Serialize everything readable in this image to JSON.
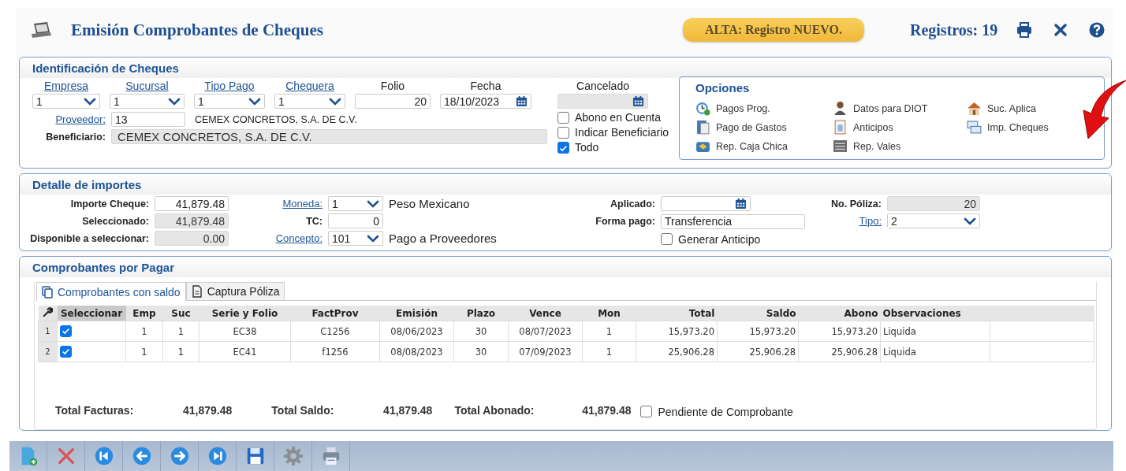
{
  "header": {
    "title": "Emisión Comprobantes de Cheques",
    "badge": "ALTA: Registro NUEVO.",
    "records": "Registros: 19"
  },
  "identificacion": {
    "title": "Identificación de Cheques",
    "selects": [
      {
        "label": "Empresa",
        "value": "1"
      },
      {
        "label": "Sucursal",
        "value": "1"
      },
      {
        "label": "Tipo Pago",
        "value": "1"
      },
      {
        "label": "Chequera",
        "value": "1"
      }
    ],
    "folio": {
      "label": "Folio",
      "value": "20"
    },
    "fecha": {
      "label": "Fecha",
      "value": "18/10/2023"
    },
    "cancelado": {
      "label": "Cancelado"
    },
    "checks": [
      {
        "label": "Abono en Cuenta",
        "checked": false
      },
      {
        "label": "Indicar Beneficiario",
        "checked": false
      },
      {
        "label": "Todo",
        "checked": true
      }
    ],
    "proveedor": {
      "label": "Proveedor:",
      "value": "13",
      "name": "CEMEX CONCRETOS, S.A. DE C.V."
    },
    "beneficiario": {
      "label": "Beneficiario:",
      "value": "CEMEX CONCRETOS, S.A. DE C.V."
    }
  },
  "opciones": {
    "title": "Opciones",
    "items": [
      "Pagos Prog.",
      "Datos para DIOT",
      "Suc. Aplica",
      "Pago de Gastos",
      "Anticipos",
      "Imp. Cheques",
      "Rep. Caja Chica",
      "Rep. Vales"
    ]
  },
  "detalle": {
    "title": "Detalle de importes",
    "importes": [
      {
        "label": "Importe Cheque:",
        "value": "41,879.48",
        "readonly": false
      },
      {
        "label": "Seleccionado:",
        "value": "41,879.48",
        "readonly": true
      },
      {
        "label": "Disponible a seleccionar:",
        "value": "0.00",
        "readonly": true
      }
    ],
    "moneda": {
      "label": "Moneda:",
      "value": "1",
      "description": "Peso Mexicano"
    },
    "tc": {
      "label": "TC:",
      "value": "0"
    },
    "concepto": {
      "label": "Concepto:",
      "value": "101",
      "description": "Pago a Proveedores"
    },
    "aplicado": {
      "label": "Aplicado:"
    },
    "forma_pago": {
      "label": "Forma pago:",
      "value": "Transferencia"
    },
    "generar_anticipo": {
      "label": "Generar Anticipo",
      "checked": false
    },
    "poliza": {
      "label": "No. Póliza:",
      "value": "20"
    },
    "tipo": {
      "label": "Tipo:",
      "value": "2"
    }
  },
  "comprobantes": {
    "title": "Comprobantes por Pagar",
    "tabs": [
      {
        "label": "Comprobantes con saldo",
        "selected": true
      },
      {
        "label": "Captura Póliza",
        "selected": false
      }
    ],
    "table": {
      "select_column": "Seleccionar",
      "columns": [
        "Emp",
        "Suc",
        "Serie y Folio",
        "FactProv",
        "Emisión",
        "Plazo",
        "Vence",
        "Mon",
        "Total",
        "Saldo",
        "Abono",
        "Observaciones"
      ],
      "rows": [
        {
          "number": "1",
          "checked": true,
          "cells": [
            "1",
            "1",
            "EC38",
            "C1256",
            "08/06/2023",
            "30",
            "08/07/2023",
            "1",
            "15,973.20",
            "15,973.20",
            "15,973.20",
            "Liquida"
          ]
        },
        {
          "number": "2",
          "checked": true,
          "cells": [
            "1",
            "1",
            "EC41",
            "f1256",
            "08/08/2023",
            "30",
            "07/09/2023",
            "1",
            "25,906.28",
            "25,906.28",
            "25,906.28",
            "Liquida"
          ]
        }
      ]
    },
    "totals": [
      {
        "label": "Total Facturas:",
        "value": "41,879.48"
      },
      {
        "label": "Total Saldo:",
        "value": "41,879.48"
      },
      {
        "label": "Total Abonado:",
        "value": "41,879.48"
      }
    ],
    "pendiente": {
      "label": "Pendiente de Comprobante",
      "checked": false
    }
  }
}
